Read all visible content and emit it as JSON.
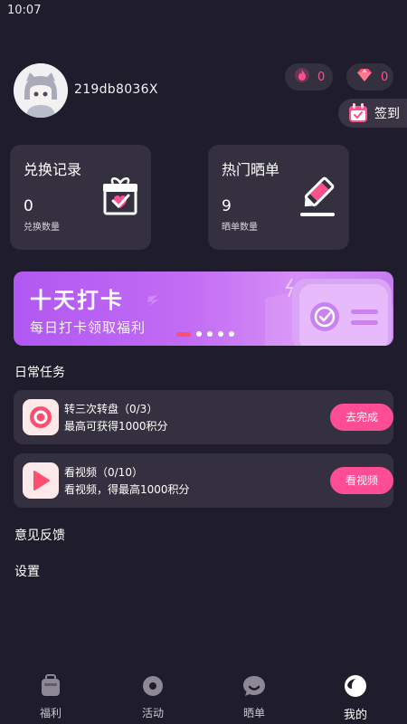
{
  "status_bar": {
    "time": "10:07"
  },
  "profile": {
    "username": "219db8036X"
  },
  "stats": {
    "fire_count": "0",
    "gem_count": "0"
  },
  "signin": {
    "label": "签到"
  },
  "cards": [
    {
      "title": "兑换记录",
      "count": "0",
      "sub": "兑换数量"
    },
    {
      "title": "热门晒单",
      "count": "9",
      "sub": "晒单数量"
    }
  ],
  "banner": {
    "title": "十天打卡",
    "subtitle": "每日打卡领取福利",
    "page_count": 5,
    "active_page": 1
  },
  "tasks_section": {
    "title": "日常任务"
  },
  "tasks": [
    {
      "name": "转三次转盘（0/3）",
      "desc": "最高可获得1000积分",
      "button": "去完成"
    },
    {
      "name": "看视频（0/10）",
      "desc": "看视频，得最高1000积分",
      "button": "看视频"
    }
  ],
  "menu": {
    "feedback": "意见反馈",
    "settings": "设置"
  },
  "tabs": [
    {
      "label": "福利"
    },
    {
      "label": "活动"
    },
    {
      "label": "晒单"
    },
    {
      "label": "我的"
    }
  ],
  "colors": {
    "background": "#1f1c2b",
    "card": "#35303f",
    "accent": "#ff4d95"
  }
}
